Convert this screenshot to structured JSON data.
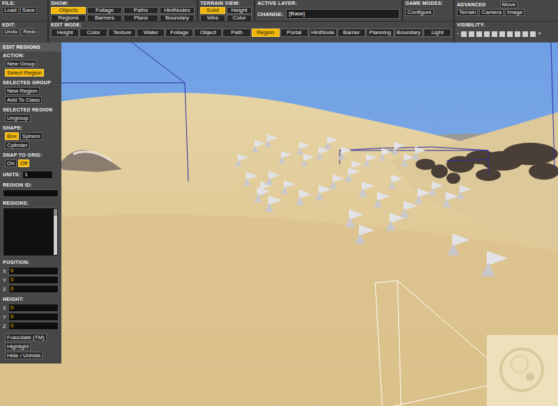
{
  "toolbar": {
    "file": {
      "label": "FILE:",
      "buttons": [
        {
          "label": "Load",
          "selected": false
        },
        {
          "label": "Save",
          "selected": false
        }
      ]
    },
    "show": {
      "label": "SHOW:",
      "buttons": [
        {
          "label": "Objects",
          "selected": true
        },
        {
          "label": "Foliage",
          "selected": false
        },
        {
          "label": "Paths",
          "selected": false
        },
        {
          "label": "HintNodes",
          "selected": false
        },
        {
          "label": "Regions",
          "selected": false
        },
        {
          "label": "Barriers",
          "selected": false
        },
        {
          "label": "Plans",
          "selected": false
        },
        {
          "label": "Boundary",
          "selected": false
        }
      ]
    },
    "terrain_view": {
      "label": "TERRAIN VIEW:",
      "buttons": [
        {
          "label": "Solid",
          "selected": true
        },
        {
          "label": "Height",
          "selected": false
        },
        {
          "label": "Wire",
          "selected": false
        },
        {
          "label": "Color",
          "selected": false
        }
      ]
    },
    "active_layer": {
      "label": "ACTIVE LAYER:",
      "change_label": "CHANGE:",
      "value": "[Base]"
    },
    "game_modes": {
      "label": "GAME MODES:",
      "buttons": [
        {
          "label": "Configure",
          "selected": false
        }
      ]
    },
    "advanced": {
      "label": "ADVANCED",
      "top_button": {
        "label": "Move",
        "selected": false
      },
      "buttons": [
        {
          "label": "Terrain",
          "selected": false
        },
        {
          "label": "Camera",
          "selected": false
        },
        {
          "label": "Image",
          "selected": false
        }
      ]
    },
    "edit": {
      "label": "EDIT:",
      "buttons": [
        {
          "label": "Undo",
          "selected": false
        },
        {
          "label": "Redo",
          "selected": false
        }
      ]
    },
    "edit_mode": {
      "label": "EDIT MODE:",
      "buttons": [
        {
          "label": "Height",
          "selected": false
        },
        {
          "label": "Color",
          "selected": false
        },
        {
          "label": "Texture",
          "selected": false
        },
        {
          "label": "Water",
          "selected": false
        },
        {
          "label": "Foliage",
          "selected": false
        },
        {
          "label": "Object",
          "selected": false
        },
        {
          "label": "Path",
          "selected": false
        },
        {
          "label": "Region",
          "selected": true
        },
        {
          "label": "Portal",
          "selected": false
        },
        {
          "label": "HintNode",
          "selected": false
        },
        {
          "label": "Barrier",
          "selected": false
        },
        {
          "label": "Planning",
          "selected": false
        },
        {
          "label": "Boundary",
          "selected": false
        },
        {
          "label": "Light",
          "selected": false
        }
      ]
    },
    "visibility": {
      "label": "VISIBILITY:",
      "minus": "-",
      "plus": "+",
      "slots": [
        {
          "on": true
        },
        {
          "on": true
        },
        {
          "on": true
        },
        {
          "on": true
        },
        {
          "on": true
        },
        {
          "on": true
        },
        {
          "on": true
        },
        {
          "on": true
        },
        {
          "on": true
        },
        {
          "on": true
        }
      ]
    }
  },
  "sidebar": {
    "title": "EDIT REGIONS",
    "sections": [
      {
        "kind": "stack",
        "label": "ACTION:",
        "buttons": [
          {
            "label": "New Group",
            "selected": false
          },
          {
            "label": "Select Region",
            "selected": true
          }
        ]
      },
      {
        "kind": "stack",
        "label": "SELECTED GROUP",
        "buttons": [
          {
            "label": "New Region",
            "selected": false
          },
          {
            "label": "Add To Class",
            "selected": false
          }
        ]
      },
      {
        "kind": "stack",
        "label": "SELECTED REGION",
        "buttons": [
          {
            "label": "Ungroup",
            "selected": false
          }
        ]
      },
      {
        "kind": "row",
        "label": "SHAPE:",
        "buttons": [
          {
            "label": "Box",
            "selected": true
          },
          {
            "label": "Sphere",
            "selected": false
          },
          {
            "label": "Cylinder",
            "selected": false
          }
        ]
      },
      {
        "kind": "row",
        "label": "SNAP TO GRID:",
        "buttons": [
          {
            "label": "On",
            "selected": false
          },
          {
            "label": "Off",
            "selected": true
          }
        ]
      },
      {
        "kind": "units",
        "label": "UNITS:",
        "value": "1"
      },
      {
        "kind": "field",
        "label": "REGION ID:",
        "value": ""
      },
      {
        "kind": "list",
        "label": "REGIONS:",
        "items": []
      },
      {
        "kind": "xyz",
        "label": "POSITION:",
        "fields": [
          {
            "axis": "X",
            "value": "0"
          },
          {
            "axis": "Y",
            "value": "0"
          },
          {
            "axis": "Z",
            "value": "0"
          }
        ]
      },
      {
        "kind": "xyz",
        "label": "HEIGHT:",
        "fields": [
          {
            "axis": "X",
            "value": "0"
          },
          {
            "axis": "Y",
            "value": "0"
          },
          {
            "axis": "Z",
            "value": "0"
          }
        ]
      },
      {
        "kind": "stack",
        "label": "",
        "buttons": [
          {
            "label": "Fusculate (TM)",
            "selected": false
          },
          {
            "label": "Highlight",
            "selected": false
          },
          {
            "label": "Hide / Unhide",
            "selected": false
          }
        ]
      }
    ]
  }
}
